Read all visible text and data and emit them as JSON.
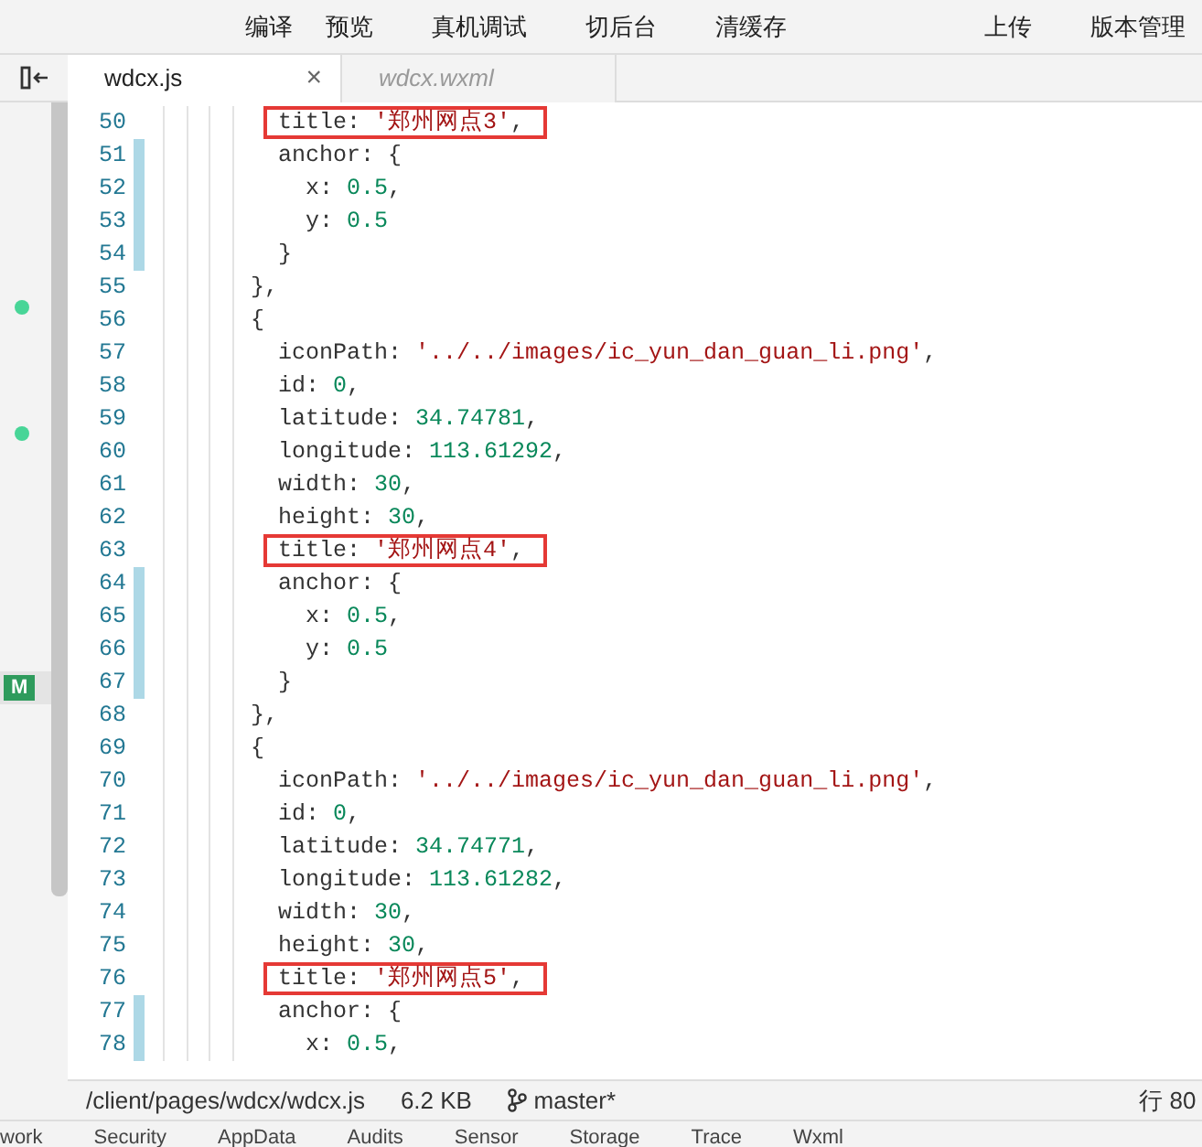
{
  "toolbar": {
    "actions": [
      "编译",
      "预览",
      "真机调试",
      "切后台",
      "清缓存"
    ],
    "right_actions": [
      "上传",
      "版本管理"
    ]
  },
  "tabs": [
    {
      "label": "wdcx.js",
      "selected": true,
      "close": "×"
    },
    {
      "label": "wdcx.wxml",
      "selected": false
    }
  ],
  "side_markers": [
    {
      "kind": "dot"
    },
    {
      "kind": "dot"
    },
    {
      "kind": "badge",
      "text": "M"
    }
  ],
  "editor": {
    "lines": [
      {
        "number": "50",
        "changed": false,
        "boxed": true,
        "tokens": [
          {
            "kind": "plain",
            "text": "        title: "
          },
          {
            "kind": "string",
            "text": "'郑州网点3'"
          },
          {
            "kind": "plain",
            "text": ","
          }
        ]
      },
      {
        "number": "51",
        "changed": true,
        "boxed": false,
        "tokens": [
          {
            "kind": "plain",
            "text": "        anchor: {"
          }
        ]
      },
      {
        "number": "52",
        "changed": true,
        "boxed": false,
        "tokens": [
          {
            "kind": "plain",
            "text": "          x: "
          },
          {
            "kind": "number",
            "text": "0.5"
          },
          {
            "kind": "plain",
            "text": ","
          }
        ]
      },
      {
        "number": "53",
        "changed": true,
        "boxed": false,
        "tokens": [
          {
            "kind": "plain",
            "text": "          y: "
          },
          {
            "kind": "number",
            "text": "0.5"
          }
        ]
      },
      {
        "number": "54",
        "changed": true,
        "boxed": false,
        "tokens": [
          {
            "kind": "plain",
            "text": "        }"
          }
        ]
      },
      {
        "number": "55",
        "changed": false,
        "boxed": false,
        "tokens": [
          {
            "kind": "plain",
            "text": "      },"
          }
        ]
      },
      {
        "number": "56",
        "changed": false,
        "boxed": false,
        "tokens": [
          {
            "kind": "plain",
            "text": "      {"
          }
        ]
      },
      {
        "number": "57",
        "changed": false,
        "boxed": false,
        "tokens": [
          {
            "kind": "plain",
            "text": "        iconPath: "
          },
          {
            "kind": "string",
            "text": "'../../images/ic_yun_dan_guan_li.png'"
          },
          {
            "kind": "plain",
            "text": ","
          }
        ]
      },
      {
        "number": "58",
        "changed": false,
        "boxed": false,
        "tokens": [
          {
            "kind": "plain",
            "text": "        id: "
          },
          {
            "kind": "number",
            "text": "0"
          },
          {
            "kind": "plain",
            "text": ","
          }
        ]
      },
      {
        "number": "59",
        "changed": false,
        "boxed": false,
        "tokens": [
          {
            "kind": "plain",
            "text": "        latitude: "
          },
          {
            "kind": "number",
            "text": "34.74781"
          },
          {
            "kind": "plain",
            "text": ","
          }
        ]
      },
      {
        "number": "60",
        "changed": false,
        "boxed": false,
        "tokens": [
          {
            "kind": "plain",
            "text": "        longitude: "
          },
          {
            "kind": "number",
            "text": "113.61292"
          },
          {
            "kind": "plain",
            "text": ","
          }
        ]
      },
      {
        "number": "61",
        "changed": false,
        "boxed": false,
        "tokens": [
          {
            "kind": "plain",
            "text": "        width: "
          },
          {
            "kind": "number",
            "text": "30"
          },
          {
            "kind": "plain",
            "text": ","
          }
        ]
      },
      {
        "number": "62",
        "changed": false,
        "boxed": false,
        "tokens": [
          {
            "kind": "plain",
            "text": "        height: "
          },
          {
            "kind": "number",
            "text": "30"
          },
          {
            "kind": "plain",
            "text": ","
          }
        ]
      },
      {
        "number": "63",
        "changed": false,
        "boxed": true,
        "tokens": [
          {
            "kind": "plain",
            "text": "        title: "
          },
          {
            "kind": "string",
            "text": "'郑州网点4'"
          },
          {
            "kind": "plain",
            "text": ","
          }
        ]
      },
      {
        "number": "64",
        "changed": true,
        "boxed": false,
        "tokens": [
          {
            "kind": "plain",
            "text": "        anchor: {"
          }
        ]
      },
      {
        "number": "65",
        "changed": true,
        "boxed": false,
        "tokens": [
          {
            "kind": "plain",
            "text": "          x: "
          },
          {
            "kind": "number",
            "text": "0.5"
          },
          {
            "kind": "plain",
            "text": ","
          }
        ]
      },
      {
        "number": "66",
        "changed": true,
        "boxed": false,
        "tokens": [
          {
            "kind": "plain",
            "text": "          y: "
          },
          {
            "kind": "number",
            "text": "0.5"
          }
        ]
      },
      {
        "number": "67",
        "changed": true,
        "boxed": false,
        "tokens": [
          {
            "kind": "plain",
            "text": "        }"
          }
        ]
      },
      {
        "number": "68",
        "changed": false,
        "boxed": false,
        "tokens": [
          {
            "kind": "plain",
            "text": "      },"
          }
        ]
      },
      {
        "number": "69",
        "changed": false,
        "boxed": false,
        "tokens": [
          {
            "kind": "plain",
            "text": "      {"
          }
        ]
      },
      {
        "number": "70",
        "changed": false,
        "boxed": false,
        "tokens": [
          {
            "kind": "plain",
            "text": "        iconPath: "
          },
          {
            "kind": "string",
            "text": "'../../images/ic_yun_dan_guan_li.png'"
          },
          {
            "kind": "plain",
            "text": ","
          }
        ]
      },
      {
        "number": "71",
        "changed": false,
        "boxed": false,
        "tokens": [
          {
            "kind": "plain",
            "text": "        id: "
          },
          {
            "kind": "number",
            "text": "0"
          },
          {
            "kind": "plain",
            "text": ","
          }
        ]
      },
      {
        "number": "72",
        "changed": false,
        "boxed": false,
        "tokens": [
          {
            "kind": "plain",
            "text": "        latitude: "
          },
          {
            "kind": "number",
            "text": "34.74771"
          },
          {
            "kind": "plain",
            "text": ","
          }
        ]
      },
      {
        "number": "73",
        "changed": false,
        "boxed": false,
        "tokens": [
          {
            "kind": "plain",
            "text": "        longitude: "
          },
          {
            "kind": "number",
            "text": "113.61282"
          },
          {
            "kind": "plain",
            "text": ","
          }
        ]
      },
      {
        "number": "74",
        "changed": false,
        "boxed": false,
        "tokens": [
          {
            "kind": "plain",
            "text": "        width: "
          },
          {
            "kind": "number",
            "text": "30"
          },
          {
            "kind": "plain",
            "text": ","
          }
        ]
      },
      {
        "number": "75",
        "changed": false,
        "boxed": false,
        "tokens": [
          {
            "kind": "plain",
            "text": "        height: "
          },
          {
            "kind": "number",
            "text": "30"
          },
          {
            "kind": "plain",
            "text": ","
          }
        ]
      },
      {
        "number": "76",
        "changed": false,
        "boxed": true,
        "tokens": [
          {
            "kind": "plain",
            "text": "        title: "
          },
          {
            "kind": "string",
            "text": "'郑州网点5'"
          },
          {
            "kind": "plain",
            "text": ","
          }
        ]
      },
      {
        "number": "77",
        "changed": true,
        "boxed": false,
        "tokens": [
          {
            "kind": "plain",
            "text": "        anchor: {"
          }
        ]
      },
      {
        "number": "78",
        "changed": true,
        "boxed": false,
        "tokens": [
          {
            "kind": "plain",
            "text": "          x: "
          },
          {
            "kind": "number",
            "text": "0.5"
          },
          {
            "kind": "plain",
            "text": ","
          }
        ]
      }
    ]
  },
  "status_bar": {
    "path": "/client/pages/wdcx/wdcx.js",
    "size": "6.2 KB",
    "branch": "master*",
    "position": "行 80"
  },
  "bottom_tabs": [
    "work",
    "Security",
    "AppData",
    "Audits",
    "Sensor",
    "Storage",
    "Trace",
    "Wxml"
  ]
}
